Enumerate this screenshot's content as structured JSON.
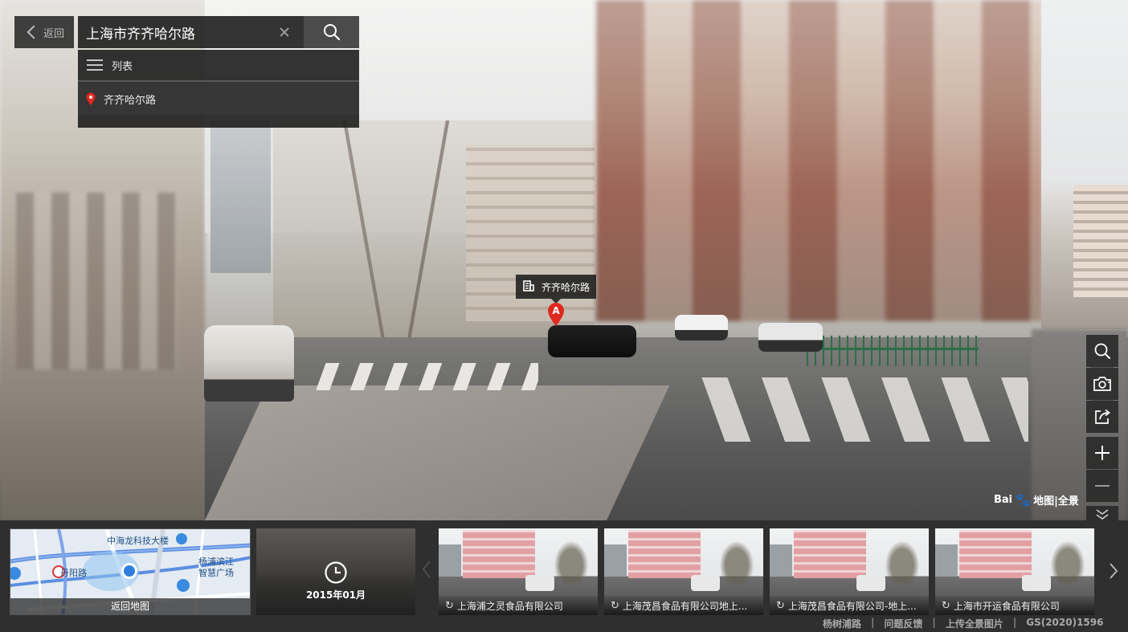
{
  "nav": {
    "back_label": "返回"
  },
  "search": {
    "value": "上海市齐齐哈尔路",
    "placeholder": ""
  },
  "results": {
    "list_label": "列表",
    "items": [
      {
        "label": "齐齐哈尔路"
      }
    ]
  },
  "scene": {
    "poi_label": "齐齐哈尔路",
    "marker_letter": "A",
    "brand_text": "Bai",
    "brand_suffix": "地图|全景"
  },
  "toolbar": {
    "icons": [
      "search-icon",
      "camera-icon",
      "share-icon",
      "zoom-in-icon",
      "zoom-out-icon",
      "collapse-icon"
    ]
  },
  "minimap": {
    "caption": "返回地图",
    "labels": {
      "building": "中海龙科技大楼",
      "road": "丹阳路",
      "plaza_line1": "杨浦滨江",
      "plaza_line2": "智慧广场"
    }
  },
  "time_machine": {
    "date": "2015年01月"
  },
  "nearby": [
    {
      "title": "上海浦之灵食品有限公司"
    },
    {
      "title": "上海茂昌食品有限公司地上..."
    },
    {
      "title": "上海茂昌食品有限公司-地上..."
    },
    {
      "title": "上海市开运食品有限公司"
    }
  ],
  "footer": {
    "links": [
      "杨树浦路",
      "问题反馈",
      "上传全景图片"
    ],
    "license": "GS(2020)1596"
  }
}
